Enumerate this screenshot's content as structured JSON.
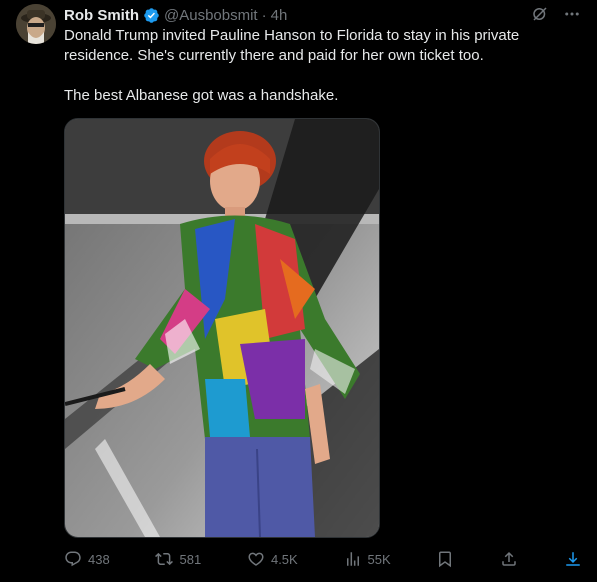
{
  "post": {
    "author_name": "Rob Smith",
    "handle": "@Ausbobsmit",
    "separator": "·",
    "time": "4h",
    "text_line1": "Donald Trump invited Pauline Hanson to Florida to stay in his private residence. She's currently there and paid for her own ticket too.",
    "text_line2": "The best Albanese got was a handshake."
  },
  "actions": {
    "replies": "438",
    "reposts": "581",
    "likes": "4.5K",
    "views": "55K"
  },
  "icons": {
    "verified": "verified-badge-icon",
    "grok": "grok-icon",
    "more": "more-icon",
    "reply": "reply-icon",
    "repost": "repost-icon",
    "like": "heart-icon",
    "views": "views-icon",
    "bookmark": "bookmark-icon",
    "share": "share-icon",
    "download": "download-icon"
  },
  "colors": {
    "background": "#000000",
    "text": "#e7e9ea",
    "muted": "#71767b",
    "verified": "#1d9bf0",
    "download": "#1d9bf0"
  }
}
